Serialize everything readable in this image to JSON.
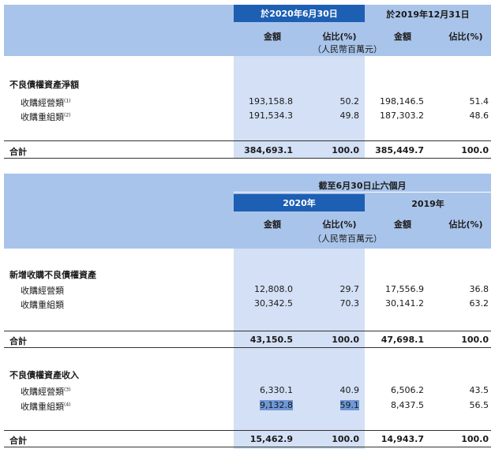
{
  "table1": {
    "period_2020": "於2020年6月30日",
    "period_2019": "於2019年12月31日",
    "col_amount": "金額",
    "col_pct": "佔比(%)",
    "unit": "（人民幣百萬元）",
    "section_title": "不良債權資產淨額",
    "rows": [
      {
        "label": "收購經營類",
        "note": "(1)",
        "a2020": "193,158.8",
        "p2020": "50.2",
        "a2019": "198,146.5",
        "p2019": "51.4"
      },
      {
        "label": "收購重組類",
        "note": "(2)",
        "a2020": "191,534.3",
        "p2020": "49.8",
        "a2019": "187,303.2",
        "p2019": "48.6"
      }
    ],
    "total": {
      "label": "合計",
      "a2020": "384,693.1",
      "p2020": "100.0",
      "a2019": "385,449.7",
      "p2019": "100.0"
    }
  },
  "table2": {
    "period_header": "截至6月30日止六個月",
    "year_2020": "2020年",
    "year_2019": "2019年",
    "col_amount": "金額",
    "col_pct": "佔比(%)",
    "unit": "（人民幣百萬元）",
    "section1_title": "新增收購不良債權資產",
    "section1_rows": [
      {
        "label": "收購經營類",
        "a2020": "12,808.0",
        "p2020": "29.7",
        "a2019": "17,556.9",
        "p2019": "36.8"
      },
      {
        "label": "收購重組類",
        "a2020": "30,342.5",
        "p2020": "70.3",
        "a2019": "30,141.2",
        "p2019": "63.2"
      }
    ],
    "section1_total": {
      "label": "合計",
      "a2020": "43,150.5",
      "p2020": "100.0",
      "a2019": "47,698.1",
      "p2019": "100.0"
    },
    "section2_title": "不良債權資產收入",
    "section2_rows": [
      {
        "label": "收購經營類",
        "note": "(3)",
        "a2020": "6,330.1",
        "p2020": "40.9",
        "a2019": "6,506.2",
        "p2019": "43.5"
      },
      {
        "label": "收購重組類",
        "note": "(4)",
        "a2020": "9,132.8",
        "p2020": "59.1",
        "a2019": "8,437.5",
        "p2019": "56.5"
      }
    ],
    "section2_total": {
      "label": "合計",
      "a2020": "15,462.9",
      "p2020": "100.0",
      "a2019": "14,943.7",
      "p2019": "100.0"
    }
  }
}
